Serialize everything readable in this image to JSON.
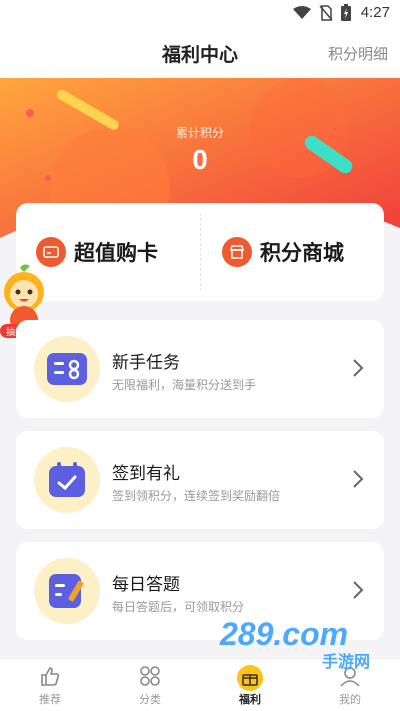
{
  "status": {
    "time": "4:27"
  },
  "header": {
    "title": "福利中心",
    "right_link": "积分明细"
  },
  "points": {
    "label": "累计积分",
    "value": "0"
  },
  "cards": [
    {
      "label": "超值购卡",
      "icon": "card-icon"
    },
    {
      "label": "积分商城",
      "icon": "store-icon"
    }
  ],
  "mascot": {
    "badge": "抽奖活动"
  },
  "tasks": [
    {
      "title": "新手任务",
      "subtitle": "无限福利，海量积分送到手",
      "icon": "task-list-icon"
    },
    {
      "title": "签到有礼",
      "subtitle": "签到领积分，连续签到奖励翻倍",
      "icon": "calendar-check-icon"
    },
    {
      "title": "每日答题",
      "subtitle": "每日答题后，可领取积分",
      "icon": "quiz-edit-icon"
    }
  ],
  "tabs": [
    {
      "label": "推荐",
      "icon": "thumbs-up-icon",
      "active": false
    },
    {
      "label": "分类",
      "icon": "grid-icon",
      "active": false
    },
    {
      "label": "福利",
      "icon": "gift-icon",
      "active": true
    },
    {
      "label": "我的",
      "icon": "user-icon",
      "active": false
    }
  ],
  "watermark": {
    "brand": "289.com",
    "sub": "手游网"
  },
  "colors": {
    "accent": "#ef5a2f",
    "banner_start": "#ff9a3c",
    "banner_end": "#f2453a",
    "icon_bg": "#fdf0c7",
    "icon_fg": "#5b5fe0"
  }
}
